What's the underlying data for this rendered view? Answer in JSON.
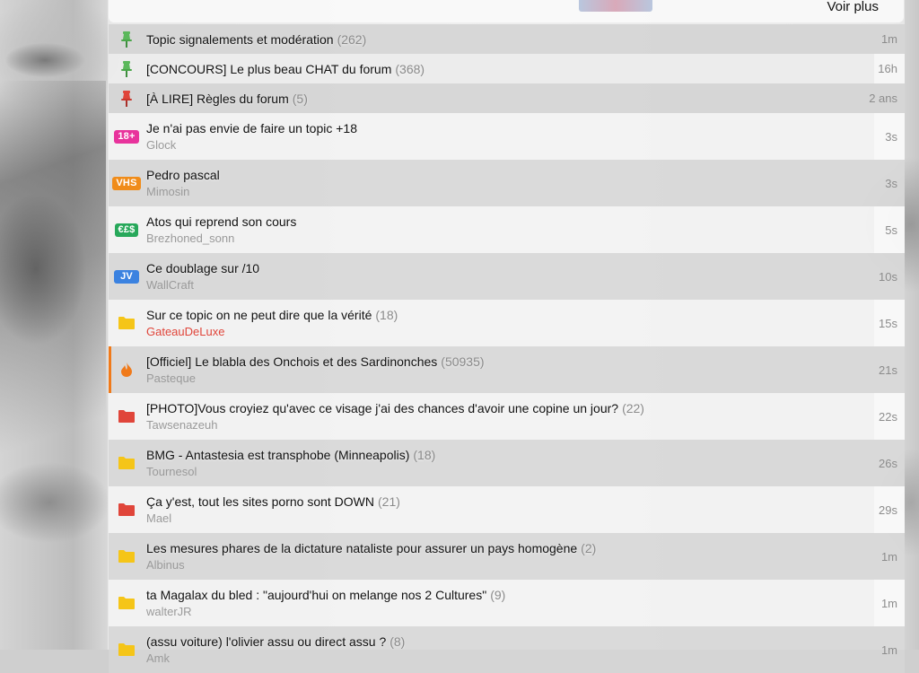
{
  "header": {
    "voir_plus": "Voir plus"
  },
  "colors": {
    "pin_green": "#5cb85c",
    "pin_red": "#e0453a",
    "folder_yellow": "#f5c518",
    "folder_red": "#e0453a",
    "flame_orange": "#f07a1a",
    "badge_18": "#e8339c",
    "badge_vhs": "#f08c1a",
    "badge_money": "#27a85a",
    "badge_jv": "#3b82e0"
  },
  "topics": [
    {
      "icon": "green-pin-icon",
      "title": "Topic signalements et modération",
      "count": "(262)",
      "author": "",
      "time": "1m"
    },
    {
      "icon": "green-pin-icon",
      "title": "[CONCOURS] Le plus beau CHAT du forum",
      "count": "(368)",
      "author": "",
      "time": "16h"
    },
    {
      "icon": "red-pin-icon",
      "title": "[À LIRE] Règles du forum",
      "count": "(5)",
      "author": "",
      "time": "2 ans"
    },
    {
      "icon": "badge-18-icon",
      "badge": "18+",
      "title": "Je n'ai pas envie de faire un topic +18",
      "count": "",
      "author": "Glock",
      "time": "3s"
    },
    {
      "icon": "badge-vhs-icon",
      "badge": "VHS",
      "title": "Pedro pascal",
      "count": "",
      "author": "Mimosin",
      "time": "3s"
    },
    {
      "icon": "badge-money-icon",
      "badge": "€£$",
      "title": "Atos qui reprend son cours",
      "count": "",
      "author": "Brezhoned_sonn",
      "time": "5s"
    },
    {
      "icon": "badge-jv-icon",
      "badge": "JV",
      "title": "Ce doublage sur /10",
      "count": "",
      "author": "WallCraft",
      "time": "10s"
    },
    {
      "icon": "yellow-folder-icon",
      "title": "Sur ce topic on ne peut dire que la vérité",
      "count": "(18)",
      "author": "GateauDeLuxe",
      "time": "15s"
    },
    {
      "icon": "flame-icon",
      "title": "[Officiel] Le blabla des Onchois et des Sardinonches",
      "count": "(50935)",
      "author": "Pasteque",
      "time": "21s"
    },
    {
      "icon": "red-folder-icon",
      "title": "[PHOTO]Vous croyiez qu'avec ce visage j'ai des chances d'avoir une copine un jour?",
      "count": "(22)",
      "author": "Tawsenazeuh",
      "time": "22s"
    },
    {
      "icon": "yellow-folder-icon",
      "title": "BMG - Antastesia est transphobe (Minneapolis)",
      "count": "(18)",
      "author": "Tournesol",
      "time": "26s"
    },
    {
      "icon": "red-folder-icon",
      "title": "Ça y'est, tout les sites porno sont DOWN",
      "count": "(21)",
      "author": "Mael",
      "time": "29s"
    },
    {
      "icon": "yellow-folder-icon",
      "title": "Les mesures phares de la dictature nataliste pour assurer un pays homogène",
      "count": "(2)",
      "author": "Albinus",
      "time": "1m"
    },
    {
      "icon": "yellow-folder-icon",
      "title": "ta Magalax du bled : \"aujourd'hui on melange nos 2 Cultures\"",
      "count": "(9)",
      "author": "walterJR",
      "time": "1m"
    },
    {
      "icon": "yellow-folder-icon",
      "title": "(assu voiture) l'olivier assu ou direct assu ?",
      "count": "(8)",
      "author": "Amk",
      "time": "1m"
    }
  ]
}
